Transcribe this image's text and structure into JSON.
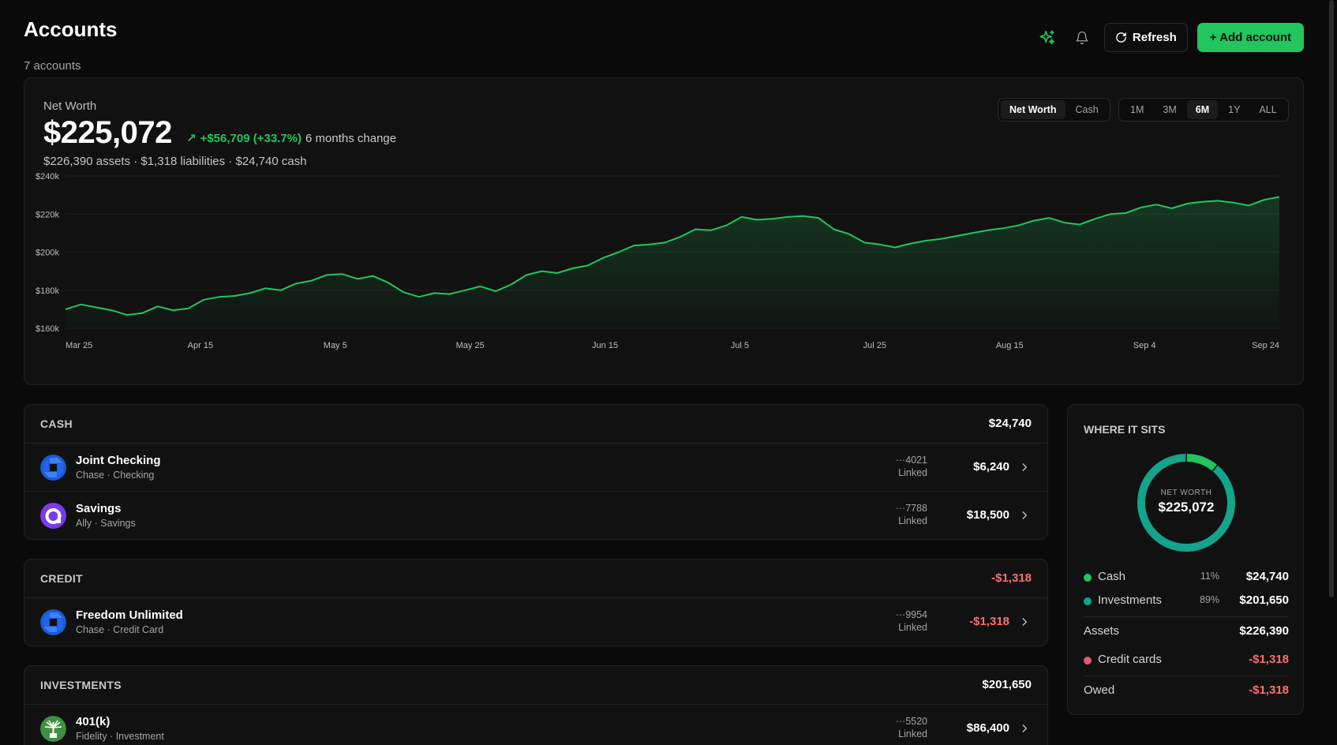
{
  "header": {
    "title": "Accounts",
    "subtitle": "7 accounts",
    "refresh_label": "Refresh",
    "add_label": "+ Add account"
  },
  "net_worth": {
    "label": "Net Worth",
    "value": "$225,072",
    "change_arrow": "↗",
    "change": "+$56,709 (+33.7%)",
    "change_period": "6 months change",
    "breakdown": "$226,390 assets · $1,318 liabilities · $24,740 cash",
    "modes": [
      "Net Worth",
      "Cash"
    ],
    "active_mode": "Net Worth",
    "ranges": [
      "1M",
      "3M",
      "6M",
      "1Y",
      "ALL"
    ],
    "active_range": "6M"
  },
  "chart_data": {
    "type": "area",
    "series": [
      {
        "values": [
          170000,
          172500,
          171000,
          169500,
          167000,
          168000,
          171500,
          169500,
          170500,
          175000,
          176500,
          177000,
          178500,
          181000,
          180000,
          183500,
          185000,
          188000,
          188500,
          186000,
          187500,
          184000,
          179000,
          176500,
          178500,
          178000,
          180000,
          182000,
          179500,
          183000,
          188000,
          190000,
          189000,
          191500,
          193000,
          197000,
          200000,
          203500,
          204000,
          205000,
          208000,
          212000,
          211500,
          214000,
          218500,
          217000,
          217500,
          218500,
          219000,
          218000,
          212000,
          209500,
          205000,
          204000,
          202500,
          204500,
          206000,
          207000,
          208500,
          210000,
          211500,
          212500,
          214000,
          216500,
          218000,
          215500,
          214500,
          217500,
          220000,
          220500,
          223500,
          225000,
          223000,
          225500,
          226500,
          227000,
          226000,
          224500,
          227500,
          229000
        ],
        "color": "#22c55e"
      }
    ],
    "x_ticks": [
      "Mar 25",
      "Apr 15",
      "May 5",
      "May 25",
      "Jun 15",
      "Jul 5",
      "Jul 25",
      "Aug 15",
      "Sep 4",
      "Sep 24"
    ],
    "y_ticks": [
      "$160k",
      "$180k",
      "$200k",
      "$220k",
      "$240k"
    ],
    "ylim": [
      160000,
      240000
    ],
    "grid": true
  },
  "sections": [
    {
      "title": "CASH",
      "total": "$24,740",
      "negative": false,
      "accounts": [
        {
          "name": "Joint Checking",
          "meta": "Chase · Checking",
          "mask": "···4021",
          "status": "Linked",
          "amount": "$6,240",
          "negative": false,
          "logo": "chase-logo"
        },
        {
          "name": "Savings",
          "meta": "Ally · Savings",
          "mask": "···7788",
          "status": "Linked",
          "amount": "$18,500",
          "negative": false,
          "logo": "ally-logo"
        }
      ]
    },
    {
      "title": "CREDIT",
      "total": "-$1,318",
      "negative": true,
      "accounts": [
        {
          "name": "Freedom Unlimited",
          "meta": "Chase · Credit Card",
          "mask": "···9954",
          "status": "Linked",
          "amount": "-$1,318",
          "negative": true,
          "logo": "chase-logo"
        }
      ]
    },
    {
      "title": "INVESTMENTS",
      "total": "$201,650",
      "negative": false,
      "accounts": [
        {
          "name": "401(k)",
          "meta": "Fidelity · Investment",
          "mask": "···5520",
          "status": "Linked",
          "amount": "$86,400",
          "negative": false,
          "logo": "fidelity-logo"
        }
      ]
    }
  ],
  "where_it_sits": {
    "title": "WHERE IT SITS",
    "donut_caption": "NET WORTH",
    "donut_value": "$225,072",
    "slices": [
      {
        "label": "Cash",
        "pct": 11,
        "pct_label": "11%",
        "value": "$24,740",
        "color": "#22c55e"
      },
      {
        "label": "Investments",
        "pct": 89,
        "pct_label": "89%",
        "value": "$201,650",
        "color": "#14a38b"
      }
    ],
    "assets_label": "Assets",
    "assets_value": "$226,390",
    "credit_label": "Credit cards",
    "credit_value": "-$1,318",
    "credit_color": "#e05d6a",
    "owed_label": "Owed",
    "owed_value": "-$1,318"
  },
  "colors": {
    "accent": "#22c55e",
    "negative": "#f87171",
    "background": "#0a0a0a",
    "card": "#111111"
  }
}
